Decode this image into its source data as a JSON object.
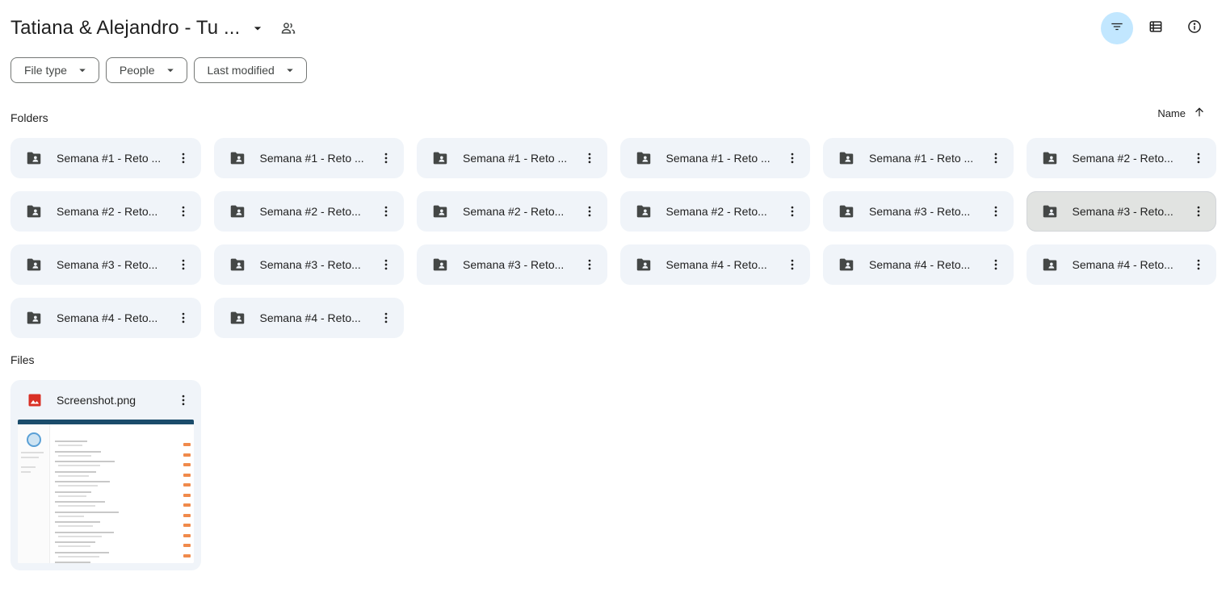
{
  "header": {
    "title": "Tatiana & Alejandro - Tu ...",
    "caret_icon": "arrow-drop-down-icon",
    "share_icon": "people-icon"
  },
  "top_actions": [
    {
      "name": "filter-button",
      "icon": "filter-list-icon",
      "active": true
    },
    {
      "name": "list-view-button",
      "icon": "view-list-icon",
      "active": false
    },
    {
      "name": "details-button",
      "icon": "info-icon",
      "active": false
    }
  ],
  "chips": [
    {
      "label": "File type"
    },
    {
      "label": "People"
    },
    {
      "label": "Last modified"
    }
  ],
  "folders_section": {
    "label": "Folders"
  },
  "sort": {
    "label": "Name",
    "direction_icon": "arrow-upward-icon"
  },
  "folders": [
    {
      "name": "Semana #1 - Reto ..."
    },
    {
      "name": "Semana #1 - Reto ..."
    },
    {
      "name": "Semana #1 - Reto ..."
    },
    {
      "name": "Semana #1 - Reto ..."
    },
    {
      "name": "Semana #1 - Reto ..."
    },
    {
      "name": "Semana #2 - Reto..."
    },
    {
      "name": "Semana #2 - Reto..."
    },
    {
      "name": "Semana #2 - Reto..."
    },
    {
      "name": "Semana #2 - Reto..."
    },
    {
      "name": "Semana #2 - Reto..."
    },
    {
      "name": "Semana #3 - Reto..."
    },
    {
      "name": "Semana #3 - Reto...",
      "selected": true
    },
    {
      "name": "Semana #3 - Reto..."
    },
    {
      "name": "Semana #3 - Reto..."
    },
    {
      "name": "Semana #3 - Reto..."
    },
    {
      "name": "Semana #4 - Reto..."
    },
    {
      "name": "Semana #4 - Reto..."
    },
    {
      "name": "Semana #4 - Reto..."
    },
    {
      "name": "Semana #4 - Reto..."
    },
    {
      "name": "Semana #4 - Reto..."
    }
  ],
  "files_section": {
    "label": "Files"
  },
  "files": [
    {
      "name": "Screenshot.png",
      "icon": "image-icon",
      "icon_color": "#d93025"
    }
  ],
  "colors": {
    "accent_active": "#c2e7ff",
    "card_bg": "#f0f4f9",
    "selected_bg": "#e1e3e1",
    "folder_icon": "#444746"
  }
}
